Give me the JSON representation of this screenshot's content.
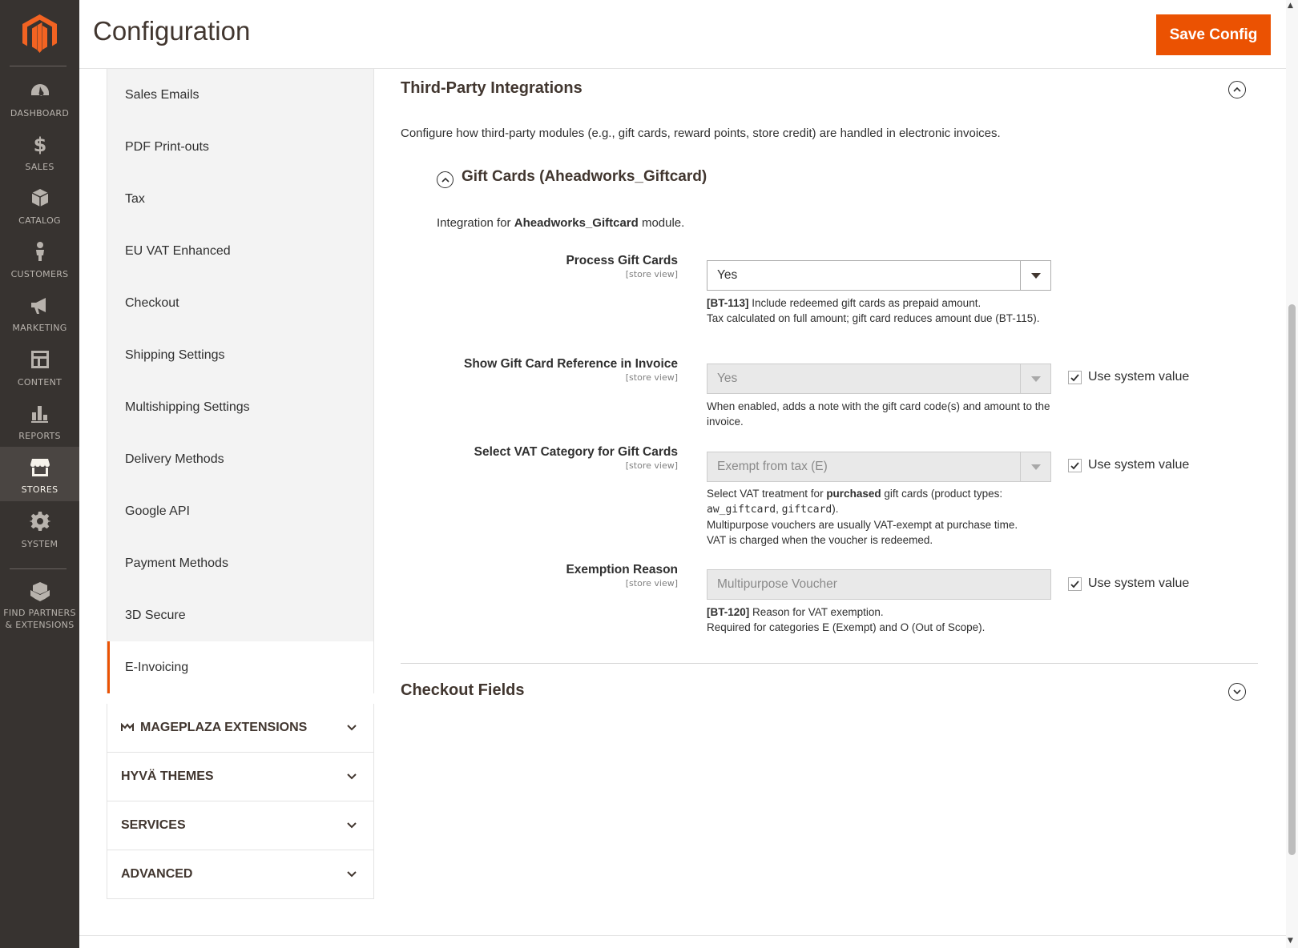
{
  "nav": {
    "items": [
      {
        "label": "DASHBOARD",
        "icon": "dashboard-icon"
      },
      {
        "label": "SALES",
        "icon": "dollar-icon"
      },
      {
        "label": "CATALOG",
        "icon": "box-icon"
      },
      {
        "label": "CUSTOMERS",
        "icon": "person-icon"
      },
      {
        "label": "MARKETING",
        "icon": "megaphone-icon"
      },
      {
        "label": "CONTENT",
        "icon": "layout-icon"
      },
      {
        "label": "REPORTS",
        "icon": "bar-chart-icon"
      },
      {
        "label": "STORES",
        "icon": "storefront-icon"
      },
      {
        "label": "SYSTEM",
        "icon": "gear-icon"
      },
      {
        "label_1": "FIND PARTNERS",
        "label_2": "& EXTENSIONS",
        "icon": "boxes-icon"
      }
    ]
  },
  "header": {
    "title": "Configuration",
    "save_label": "Save Config"
  },
  "tabs": {
    "items": [
      "Sales Emails",
      "PDF Print-outs",
      "Tax",
      "EU VAT Enhanced",
      "Checkout",
      "Shipping Settings",
      "Multishipping Settings",
      "Delivery Methods",
      "Google API",
      "Payment Methods",
      "3D Secure",
      "E-Invoicing"
    ],
    "groups": [
      "MAGEPLAZA EXTENSIONS",
      "HYVÄ THEMES",
      "SERVICES",
      "ADVANCED"
    ]
  },
  "main": {
    "section_title": "Third-Party Integrations",
    "section_desc": "Configure how third-party modules (e.g., gift cards, reward points, store credit) are handled in electronic invoices.",
    "group_title": "Gift Cards (Aheadworks_Giftcard)",
    "group_desc_pre": "Integration for ",
    "group_desc_module": "Aheadworks_Giftcard",
    "group_desc_post": " module.",
    "scope": "[store view]",
    "use_system": "Use system value",
    "fields": {
      "process": {
        "label": "Process Gift Cards",
        "value": "Yes",
        "note_code": "[BT-113]",
        "note_1": " Include redeemed gift cards as prepaid amount.",
        "note_2": "Tax calculated on full amount; gift card reduces amount due (BT-115)."
      },
      "show_ref": {
        "label": "Show Gift Card Reference in Invoice",
        "value": "Yes",
        "note": "When enabled, adds a note with the gift card code(s) and amount to the invoice."
      },
      "vat_cat": {
        "label": "Select VAT Category for Gift Cards",
        "value": "Exempt from tax (E)",
        "note_pre": "Select VAT treatment for ",
        "note_bold": "purchased",
        "note_mid": " gift cards (product types: ",
        "code_1": "aw_giftcard",
        "sep": ", ",
        "code_2": "giftcard",
        "note_end": ").",
        "note_2": "Multipurpose vouchers are usually VAT-exempt at purchase time.",
        "note_3": "VAT is charged when the voucher is redeemed."
      },
      "exemption": {
        "label": "Exemption Reason",
        "value": "Multipurpose Voucher",
        "note_code": "[BT-120]",
        "note_1": " Reason for VAT exemption.",
        "note_2": "Required for categories E (Exempt) and O (Out of Scope)."
      }
    },
    "next_section": "Checkout Fields"
  }
}
